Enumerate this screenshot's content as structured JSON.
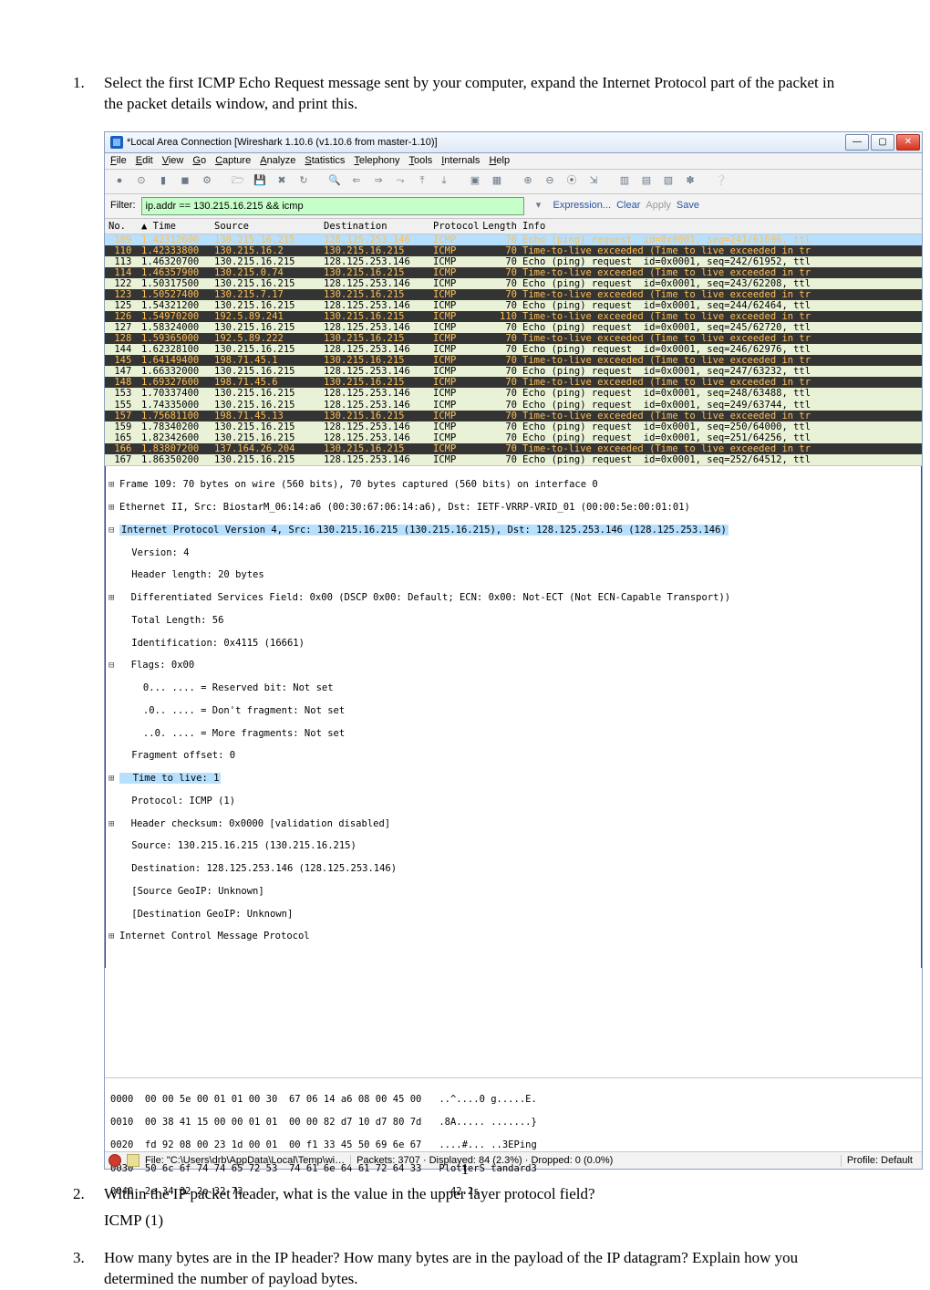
{
  "questions": {
    "q1": {
      "num": "1.",
      "text": "Select the first ICMP Echo Request message sent by your computer, expand the Internet Protocol part of the packet in the packet details window, and print this."
    },
    "q2": {
      "num": "2.",
      "text": "Within the IP packet header, what is the value in the upper layer protocol field?",
      "answer": "ICMP (1)"
    },
    "q3": {
      "num": "3.",
      "text": "How many bytes are in the IP header? How many bytes are in the payload of the IP datagram? Explain how you determined the number of payload bytes."
    }
  },
  "window": {
    "title": "*Local Area Connection  [Wireshark 1.10.6  (v1.10.6 from master-1.10)]",
    "winbtns": {
      "min": "—",
      "max": "▢",
      "close": "✕"
    }
  },
  "menu": [
    "File",
    "Edit",
    "View",
    "Go",
    "Capture",
    "Analyze",
    "Statistics",
    "Telephony",
    "Tools",
    "Internals",
    "Help"
  ],
  "filter": {
    "label": "Filter:",
    "value": "ip.addr == 130.215.16.215 && icmp",
    "dropdown": "▾",
    "links": {
      "expr": "Expression...",
      "clear": "Clear",
      "apply": "Apply",
      "save": "Save"
    }
  },
  "columns": {
    "no": "No.",
    "time": "▲ Time",
    "src": "Source",
    "dst": "Destination",
    "prot": "Protocol",
    "len": "Length",
    "info": "Info"
  },
  "packets": [
    {
      "no": "109",
      "time": "1.42312600",
      "src": "130.215.16.215",
      "dst": "128.125.253.146",
      "prot": "ICMP",
      "len": "70",
      "info": "Echo (ping) request  id=0x0001, seq=241/61696, ttl",
      "cls": "ttl sel"
    },
    {
      "no": "110",
      "time": "1.42333800",
      "src": "130.215.16.2",
      "dst": "130.215.16.215",
      "prot": "ICMP",
      "len": "70",
      "info": "Time-to-live exceeded (Time to live exceeded in tr",
      "cls": "ttl"
    },
    {
      "no": "113",
      "time": "1.46320700",
      "src": "130.215.16.215",
      "dst": "128.125.253.146",
      "prot": "ICMP",
      "len": "70",
      "info": "Echo (ping) request  id=0x0001, seq=242/61952, ttl",
      "cls": "echo"
    },
    {
      "no": "114",
      "time": "1.46357900",
      "src": "130.215.0.74",
      "dst": "130.215.16.215",
      "prot": "ICMP",
      "len": "70",
      "info": "Time-to-live exceeded (Time to live exceeded in tr",
      "cls": "ttl"
    },
    {
      "no": "122",
      "time": "1.50317500",
      "src": "130.215.16.215",
      "dst": "128.125.253.146",
      "prot": "ICMP",
      "len": "70",
      "info": "Echo (ping) request  id=0x0001, seq=243/62208, ttl",
      "cls": "echo"
    },
    {
      "no": "123",
      "time": "1.50527400",
      "src": "130.215.7.17",
      "dst": "130.215.16.215",
      "prot": "ICMP",
      "len": "70",
      "info": "Time-to-live exceeded (Time to live exceeded in tr",
      "cls": "ttl"
    },
    {
      "no": "125",
      "time": "1.54321200",
      "src": "130.215.16.215",
      "dst": "128.125.253.146",
      "prot": "ICMP",
      "len": "70",
      "info": "Echo (ping) request  id=0x0001, seq=244/62464, ttl",
      "cls": "echo"
    },
    {
      "no": "126",
      "time": "1.54970200",
      "src": "192.5.89.241",
      "dst": "130.215.16.215",
      "prot": "ICMP",
      "len": "110",
      "info": "Time-to-live exceeded (Time to live exceeded in tr",
      "cls": "ttl"
    },
    {
      "no": "127",
      "time": "1.58324000",
      "src": "130.215.16.215",
      "dst": "128.125.253.146",
      "prot": "ICMP",
      "len": "70",
      "info": "Echo (ping) request  id=0x0001, seq=245/62720, ttl",
      "cls": "echo"
    },
    {
      "no": "128",
      "time": "1.59365000",
      "src": "192.5.89.222",
      "dst": "130.215.16.215",
      "prot": "ICMP",
      "len": "70",
      "info": "Time-to-live exceeded (Time to live exceeded in tr",
      "cls": "ttl"
    },
    {
      "no": "144",
      "time": "1.62328100",
      "src": "130.215.16.215",
      "dst": "128.125.253.146",
      "prot": "ICMP",
      "len": "70",
      "info": "Echo (ping) request  id=0x0001, seq=246/62976, ttl",
      "cls": "echo"
    },
    {
      "no": "145",
      "time": "1.64149400",
      "src": "198.71.45.1",
      "dst": "130.215.16.215",
      "prot": "ICMP",
      "len": "70",
      "info": "Time-to-live exceeded (Time to live exceeded in tr",
      "cls": "ttl"
    },
    {
      "no": "147",
      "time": "1.66332000",
      "src": "130.215.16.215",
      "dst": "128.125.253.146",
      "prot": "ICMP",
      "len": "70",
      "info": "Echo (ping) request  id=0x0001, seq=247/63232, ttl",
      "cls": "echo"
    },
    {
      "no": "148",
      "time": "1.69327600",
      "src": "198.71.45.6",
      "dst": "130.215.16.215",
      "prot": "ICMP",
      "len": "70",
      "info": "Time-to-live exceeded (Time to live exceeded in tr",
      "cls": "ttl"
    },
    {
      "no": "153",
      "time": "1.70337400",
      "src": "130.215.16.215",
      "dst": "128.125.253.146",
      "prot": "ICMP",
      "len": "70",
      "info": "Echo (ping) request  id=0x0001, seq=248/63488, ttl",
      "cls": "echo"
    },
    {
      "no": "155",
      "time": "1.74335000",
      "src": "130.215.16.215",
      "dst": "128.125.253.146",
      "prot": "ICMP",
      "len": "70",
      "info": "Echo (ping) request  id=0x0001, seq=249/63744, ttl",
      "cls": "echo"
    },
    {
      "no": "157",
      "time": "1.75681100",
      "src": "198.71.45.13",
      "dst": "130.215.16.215",
      "prot": "ICMP",
      "len": "70",
      "info": "Time-to-live exceeded (Time to live exceeded in tr",
      "cls": "ttl"
    },
    {
      "no": "159",
      "time": "1.78340200",
      "src": "130.215.16.215",
      "dst": "128.125.253.146",
      "prot": "ICMP",
      "len": "70",
      "info": "Echo (ping) request  id=0x0001, seq=250/64000, ttl",
      "cls": "echo"
    },
    {
      "no": "165",
      "time": "1.82342600",
      "src": "130.215.16.215",
      "dst": "128.125.253.146",
      "prot": "ICMP",
      "len": "70",
      "info": "Echo (ping) request  id=0x0001, seq=251/64256, ttl",
      "cls": "echo"
    },
    {
      "no": "166",
      "time": "1.83807200",
      "src": "137.164.26.204",
      "dst": "130.215.16.215",
      "prot": "ICMP",
      "len": "70",
      "info": "Time-to-live exceeded (Time to live exceeded in tr",
      "cls": "ttl"
    },
    {
      "no": "167",
      "time": "1.86350200",
      "src": "130.215.16.215",
      "dst": "128.125.253.146",
      "prot": "ICMP",
      "len": "70",
      "info": "Echo (ping) request  id=0x0001, seq=252/64512, ttl",
      "cls": "echo"
    }
  ],
  "details": {
    "frame": "Frame 109: 70 bytes on wire (560 bits), 70 bytes captured (560 bits) on interface 0",
    "eth": "Ethernet II, Src: BiostarM_06:14:a6 (00:30:67:06:14:a6), Dst: IETF-VRRP-VRID_01 (00:00:5e:00:01:01)",
    "ip": "Internet Protocol Version 4, Src: 130.215.16.215 (130.215.16.215), Dst: 128.125.253.146 (128.125.253.146)",
    "ver": "    Version: 4",
    "hlen": "    Header length: 20 bytes",
    "dsf": "  Differentiated Services Field: 0x00 (DSCP 0x00: Default; ECN: 0x00: Not-ECT (Not ECN-Capable Transport))",
    "tlen": "    Total Length: 56",
    "ident": "    Identification: 0x4115 (16661)",
    "flagshdr": "  Flags: 0x00",
    "flag1": "      0... .... = Reserved bit: Not set",
    "flag2": "      .0.. .... = Don't fragment: Not set",
    "flag3": "      ..0. .... = More fragments: Not set",
    "foff": "    Fragment offset: 0",
    "ttl": "  Time to live: 1",
    "proto": "    Protocol: ICMP (1)",
    "cksum": "  Header checksum: 0x0000 [validation disabled]",
    "srcip": "    Source: 130.215.16.215 (130.215.16.215)",
    "dstip": "    Destination: 128.125.253.146 (128.125.253.146)",
    "sgeo": "    [Source GeoIP: Unknown]",
    "dgeo": "    [Destination GeoIP: Unknown]",
    "icmp": "Internet Control Message Protocol"
  },
  "hex": {
    "l0": "0000  00 00 5e 00 01 01 00 30  67 06 14 a6 08 00 45 00   ..^....0 g.....E.",
    "l1": "0010  00 38 41 15 00 00 01 01  00 00 82 d7 10 d7 80 7d   .8A..... .......}",
    "l2": "0020  fd 92 08 00 23 1d 00 01  00 f1 33 45 50 69 6e 67   ....#... ..3EPing",
    "l3": "0030  50 6c 6f 74 74 65 72 53  74 61 6e 64 61 72 64 33   PlotterS tandard3",
    "l4": "0040  2e 34 32 2e 32 73                                   .42.2s"
  },
  "status": {
    "file": "File: \"C:\\Users\\drb\\AppData\\Local\\Temp\\wi…",
    "packets": "Packets: 3707 · Displayed: 84 (2.3%) · Dropped: 0 (0.0%)",
    "profile": "Profile: Default"
  },
  "page_number": "1"
}
